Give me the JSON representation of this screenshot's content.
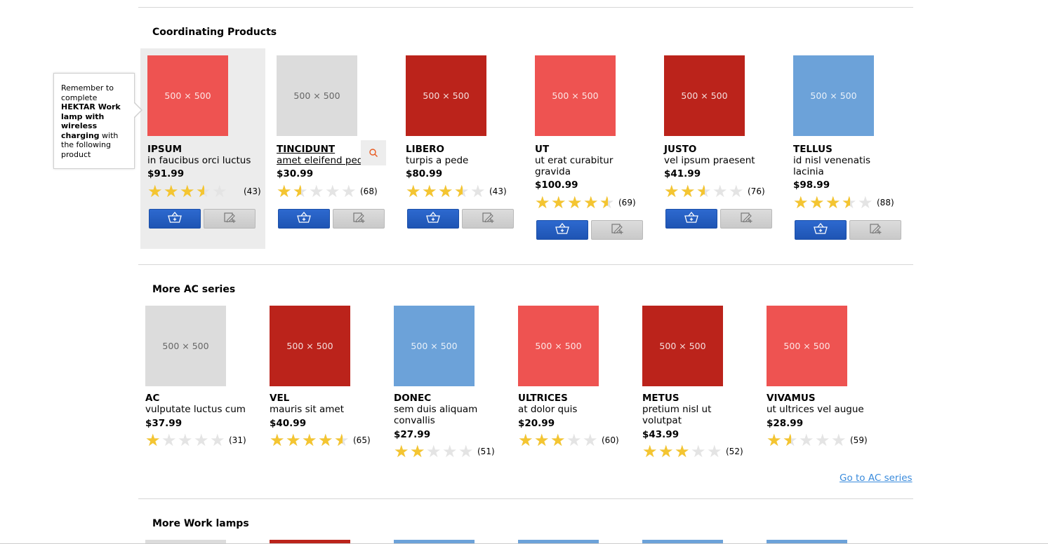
{
  "sections": [
    {
      "title": "Coordinating Products"
    },
    {
      "title": "More AC series"
    },
    {
      "title": "More Work lamps"
    }
  ],
  "tooltip": {
    "pre": "Remember to complete ",
    "bold": "HEKTAR Work lamp with wireless charging",
    "post": " with the following product"
  },
  "coordinating": [
    {
      "name": "IPSUM",
      "desc": "in faucibus orci luctus",
      "price": "$91.99",
      "rating": 3.5,
      "count": "(43)",
      "thumb": "500 × 500",
      "color": "#ee5351"
    },
    {
      "name": "TINCIDUNT",
      "desc": "amet eleifend pede",
      "price": "$30.99",
      "rating": 1.5,
      "count": "(68)",
      "thumb": "500 × 500",
      "color": "#dcdcdc"
    },
    {
      "name": "LIBERO",
      "desc": "turpis a pede",
      "price": "$80.99",
      "rating": 3.5,
      "count": "(43)",
      "thumb": "500 × 500",
      "color": "#bb231b"
    },
    {
      "name": "UT",
      "desc": "ut erat curabitur gravida",
      "price": "$100.99",
      "rating": 4.5,
      "count": "(69)",
      "thumb": "500 × 500",
      "color": "#ee5351"
    },
    {
      "name": "JUSTO",
      "desc": "vel ipsum praesent",
      "price": "$41.99",
      "rating": 2.5,
      "count": "(76)",
      "thumb": "500 × 500",
      "color": "#bb231b"
    },
    {
      "name": "TELLUS",
      "desc": "id nisl venenatis lacinia",
      "price": "$98.99",
      "rating": 3.5,
      "count": "(88)",
      "thumb": "500 × 500",
      "color": "#6ca2d9"
    }
  ],
  "ac_series": [
    {
      "name": "AC",
      "desc": "vulputate luctus cum",
      "price": "$37.99",
      "rating": 1,
      "count": "(31)",
      "thumb": "500 × 500",
      "color": "#dcdcdc"
    },
    {
      "name": "VEL",
      "desc": "mauris sit amet",
      "price": "$40.99",
      "rating": 4.5,
      "count": "(65)",
      "thumb": "500 × 500",
      "color": "#bb231b"
    },
    {
      "name": "DONEC",
      "desc": "sem duis aliquam convallis",
      "price": "$27.99",
      "rating": 2,
      "count": "(51)",
      "thumb": "500 × 500",
      "color": "#6ca2d9"
    },
    {
      "name": "ULTRICES",
      "desc": "at dolor quis",
      "price": "$20.99",
      "rating": 3,
      "count": "(60)",
      "thumb": "500 × 500",
      "color": "#ee5351"
    },
    {
      "name": "METUS",
      "desc": "pretium nisl ut volutpat",
      "price": "$43.99",
      "rating": 3,
      "count": "(52)",
      "thumb": "500 × 500",
      "color": "#bb231b"
    },
    {
      "name": "VIVAMUS",
      "desc": "ut ultrices vel augue",
      "price": "$28.99",
      "rating": 1.5,
      "count": "(59)",
      "thumb": "500 × 500",
      "color": "#ee5351"
    }
  ],
  "ac_link": "Go to AC series",
  "work_lamps_colors": [
    "#dcdcdc",
    "#bb231b",
    "#6ca2d9",
    "#6ca2d9",
    "#6ca2d9",
    "#6ca2d9"
  ],
  "icons": {
    "cart": "basket-plus-icon",
    "list": "pencil-list-icon",
    "zoom": "magnifier-icon"
  }
}
